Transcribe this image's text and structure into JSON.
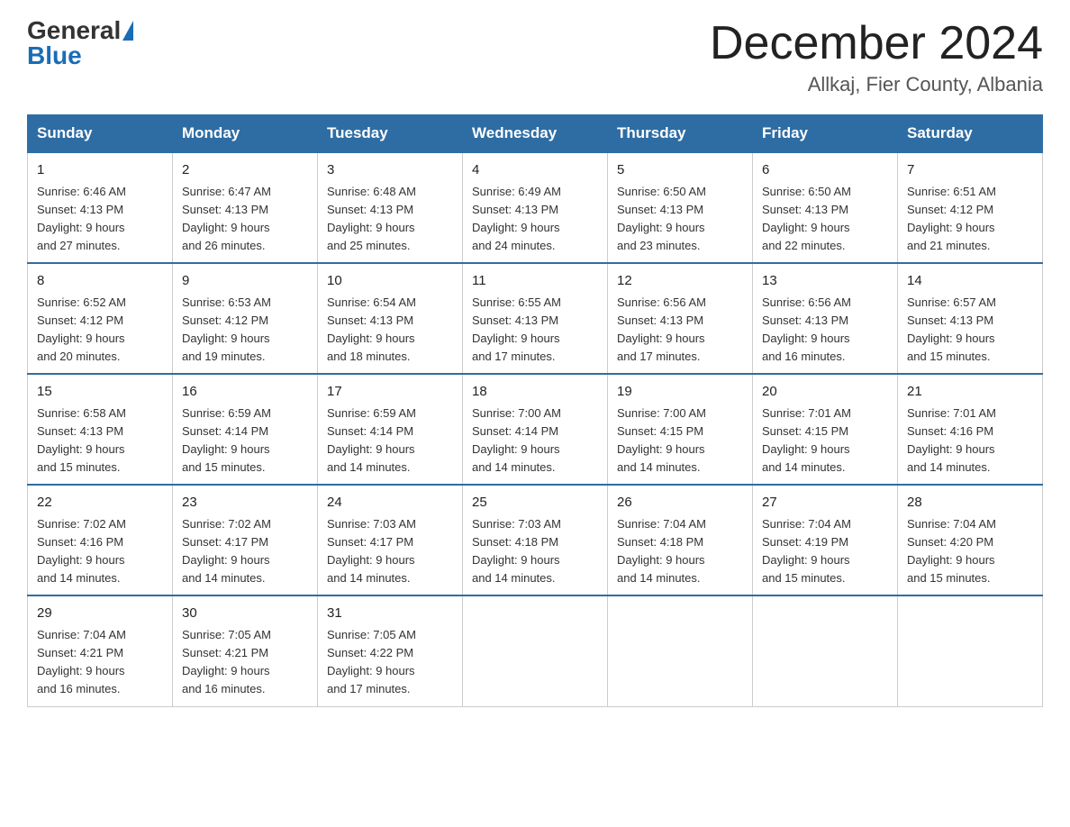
{
  "logo": {
    "general": "General",
    "blue": "Blue"
  },
  "title": "December 2024",
  "subtitle": "Allkaj, Fier County, Albania",
  "headers": [
    "Sunday",
    "Monday",
    "Tuesday",
    "Wednesday",
    "Thursday",
    "Friday",
    "Saturday"
  ],
  "weeks": [
    [
      {
        "day": "1",
        "sunrise": "6:46 AM",
        "sunset": "4:13 PM",
        "daylight": "9 hours and 27 minutes."
      },
      {
        "day": "2",
        "sunrise": "6:47 AM",
        "sunset": "4:13 PM",
        "daylight": "9 hours and 26 minutes."
      },
      {
        "day": "3",
        "sunrise": "6:48 AM",
        "sunset": "4:13 PM",
        "daylight": "9 hours and 25 minutes."
      },
      {
        "day": "4",
        "sunrise": "6:49 AM",
        "sunset": "4:13 PM",
        "daylight": "9 hours and 24 minutes."
      },
      {
        "day": "5",
        "sunrise": "6:50 AM",
        "sunset": "4:13 PM",
        "daylight": "9 hours and 23 minutes."
      },
      {
        "day": "6",
        "sunrise": "6:50 AM",
        "sunset": "4:13 PM",
        "daylight": "9 hours and 22 minutes."
      },
      {
        "day": "7",
        "sunrise": "6:51 AM",
        "sunset": "4:12 PM",
        "daylight": "9 hours and 21 minutes."
      }
    ],
    [
      {
        "day": "8",
        "sunrise": "6:52 AM",
        "sunset": "4:12 PM",
        "daylight": "9 hours and 20 minutes."
      },
      {
        "day": "9",
        "sunrise": "6:53 AM",
        "sunset": "4:12 PM",
        "daylight": "9 hours and 19 minutes."
      },
      {
        "day": "10",
        "sunrise": "6:54 AM",
        "sunset": "4:13 PM",
        "daylight": "9 hours and 18 minutes."
      },
      {
        "day": "11",
        "sunrise": "6:55 AM",
        "sunset": "4:13 PM",
        "daylight": "9 hours and 17 minutes."
      },
      {
        "day": "12",
        "sunrise": "6:56 AM",
        "sunset": "4:13 PM",
        "daylight": "9 hours and 17 minutes."
      },
      {
        "day": "13",
        "sunrise": "6:56 AM",
        "sunset": "4:13 PM",
        "daylight": "9 hours and 16 minutes."
      },
      {
        "day": "14",
        "sunrise": "6:57 AM",
        "sunset": "4:13 PM",
        "daylight": "9 hours and 15 minutes."
      }
    ],
    [
      {
        "day": "15",
        "sunrise": "6:58 AM",
        "sunset": "4:13 PM",
        "daylight": "9 hours and 15 minutes."
      },
      {
        "day": "16",
        "sunrise": "6:59 AM",
        "sunset": "4:14 PM",
        "daylight": "9 hours and 15 minutes."
      },
      {
        "day": "17",
        "sunrise": "6:59 AM",
        "sunset": "4:14 PM",
        "daylight": "9 hours and 14 minutes."
      },
      {
        "day": "18",
        "sunrise": "7:00 AM",
        "sunset": "4:14 PM",
        "daylight": "9 hours and 14 minutes."
      },
      {
        "day": "19",
        "sunrise": "7:00 AM",
        "sunset": "4:15 PM",
        "daylight": "9 hours and 14 minutes."
      },
      {
        "day": "20",
        "sunrise": "7:01 AM",
        "sunset": "4:15 PM",
        "daylight": "9 hours and 14 minutes."
      },
      {
        "day": "21",
        "sunrise": "7:01 AM",
        "sunset": "4:16 PM",
        "daylight": "9 hours and 14 minutes."
      }
    ],
    [
      {
        "day": "22",
        "sunrise": "7:02 AM",
        "sunset": "4:16 PM",
        "daylight": "9 hours and 14 minutes."
      },
      {
        "day": "23",
        "sunrise": "7:02 AM",
        "sunset": "4:17 PM",
        "daylight": "9 hours and 14 minutes."
      },
      {
        "day": "24",
        "sunrise": "7:03 AM",
        "sunset": "4:17 PM",
        "daylight": "9 hours and 14 minutes."
      },
      {
        "day": "25",
        "sunrise": "7:03 AM",
        "sunset": "4:18 PM",
        "daylight": "9 hours and 14 minutes."
      },
      {
        "day": "26",
        "sunrise": "7:04 AM",
        "sunset": "4:18 PM",
        "daylight": "9 hours and 14 minutes."
      },
      {
        "day": "27",
        "sunrise": "7:04 AM",
        "sunset": "4:19 PM",
        "daylight": "9 hours and 15 minutes."
      },
      {
        "day": "28",
        "sunrise": "7:04 AM",
        "sunset": "4:20 PM",
        "daylight": "9 hours and 15 minutes."
      }
    ],
    [
      {
        "day": "29",
        "sunrise": "7:04 AM",
        "sunset": "4:21 PM",
        "daylight": "9 hours and 16 minutes."
      },
      {
        "day": "30",
        "sunrise": "7:05 AM",
        "sunset": "4:21 PM",
        "daylight": "9 hours and 16 minutes."
      },
      {
        "day": "31",
        "sunrise": "7:05 AM",
        "sunset": "4:22 PM",
        "daylight": "9 hours and 17 minutes."
      },
      null,
      null,
      null,
      null
    ]
  ]
}
